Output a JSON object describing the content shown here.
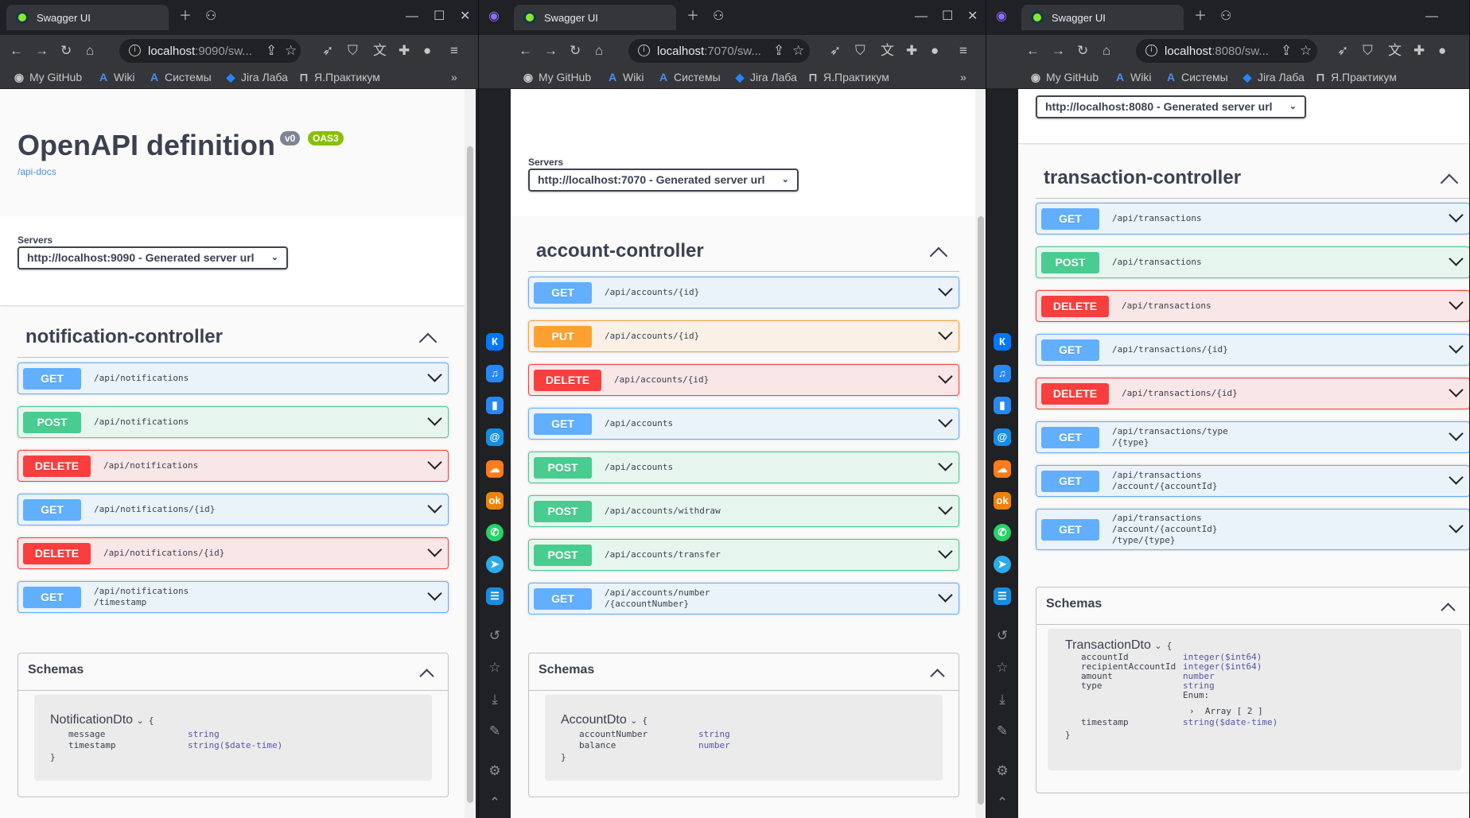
{
  "tab_title": "Swagger UI",
  "bookmarks": [
    "My GitHub",
    "Wiki",
    "Системы",
    "Jira Лаба",
    "Я.Практикум"
  ],
  "bookmarks_more": "»",
  "windows": [
    {
      "url_host": "localhost",
      "url_rest": ":9090/sw...",
      "title": "OpenAPI definition",
      "version_badge": "v0",
      "oas_badge": "OAS3",
      "api_docs_link": "/api-docs",
      "servers_label": "Servers",
      "server": "http://localhost:9090 - Generated server url",
      "controller": "notification-controller",
      "operations": [
        {
          "method": "GET",
          "path": "/api/notifications"
        },
        {
          "method": "POST",
          "path": "/api/notifications"
        },
        {
          "method": "DELETE",
          "path": "/api/notifications"
        },
        {
          "method": "GET",
          "path": "/api/notifications/{id}"
        },
        {
          "method": "DELETE",
          "path": "/api/notifications/{id}"
        },
        {
          "method": "GET",
          "path": "/api/notifications\n/timestamp"
        }
      ],
      "schemas_label": "Schemas",
      "model_name": "NotificationDto",
      "model_brace": "{",
      "model_close": "}",
      "fields": [
        {
          "name": "message",
          "type": "string"
        },
        {
          "name": "timestamp",
          "type": "string($date-time)"
        }
      ]
    },
    {
      "url_host": "localhost",
      "url_rest": ":7070/sw...",
      "servers_label": "Servers",
      "server": "http://localhost:7070 - Generated server url",
      "controller": "account-controller",
      "operations": [
        {
          "method": "GET",
          "path": "/api/accounts/{id}"
        },
        {
          "method": "PUT",
          "path": "/api/accounts/{id}"
        },
        {
          "method": "DELETE",
          "path": "/api/accounts/{id}"
        },
        {
          "method": "GET",
          "path": "/api/accounts"
        },
        {
          "method": "POST",
          "path": "/api/accounts"
        },
        {
          "method": "POST",
          "path": "/api/accounts/withdraw"
        },
        {
          "method": "POST",
          "path": "/api/accounts/transfer"
        },
        {
          "method": "GET",
          "path": "/api/accounts/number\n/{accountNumber}"
        }
      ],
      "schemas_label": "Schemas",
      "model_name": "AccountDto",
      "model_brace": "{",
      "model_close": "}",
      "fields": [
        {
          "name": "accountNumber",
          "type": "string"
        },
        {
          "name": "balance",
          "type": "number"
        }
      ]
    },
    {
      "url_host": "localhost",
      "url_rest": ":8080/sw...",
      "server": "http://localhost:8080 - Generated server url",
      "controller": "transaction-controller",
      "operations": [
        {
          "method": "GET",
          "path": "/api/transactions"
        },
        {
          "method": "POST",
          "path": "/api/transactions"
        },
        {
          "method": "DELETE",
          "path": "/api/transactions"
        },
        {
          "method": "GET",
          "path": "/api/transactions/{id}"
        },
        {
          "method": "DELETE",
          "path": "/api/transactions/{id}"
        },
        {
          "method": "GET",
          "path": "/api/transactions/type\n/{type}"
        },
        {
          "method": "GET",
          "path": "/api/transactions\n/account/{accountId}"
        },
        {
          "method": "GET",
          "path": "/api/transactions\n/account/{accountId}\n/type/{type}"
        }
      ],
      "schemas_label": "Schemas",
      "model_name": "TransactionDto",
      "model_brace": "{",
      "model_close": "}",
      "fields": [
        {
          "name": "accountId",
          "type": "integer($int64)"
        },
        {
          "name": "recipientAccountId",
          "type": "integer($int64)"
        },
        {
          "name": "amount",
          "type": "number"
        },
        {
          "name": "type",
          "type": "string"
        },
        {
          "name": "timestamp",
          "type": "string($date-time)"
        }
      ],
      "enum_label": "Enum:",
      "enum_value": "Array [ 2 ]"
    }
  ],
  "colors": {
    "get": "#61affe",
    "post": "#49cc90",
    "delete": "#f93e3e",
    "put": "#fca130"
  }
}
